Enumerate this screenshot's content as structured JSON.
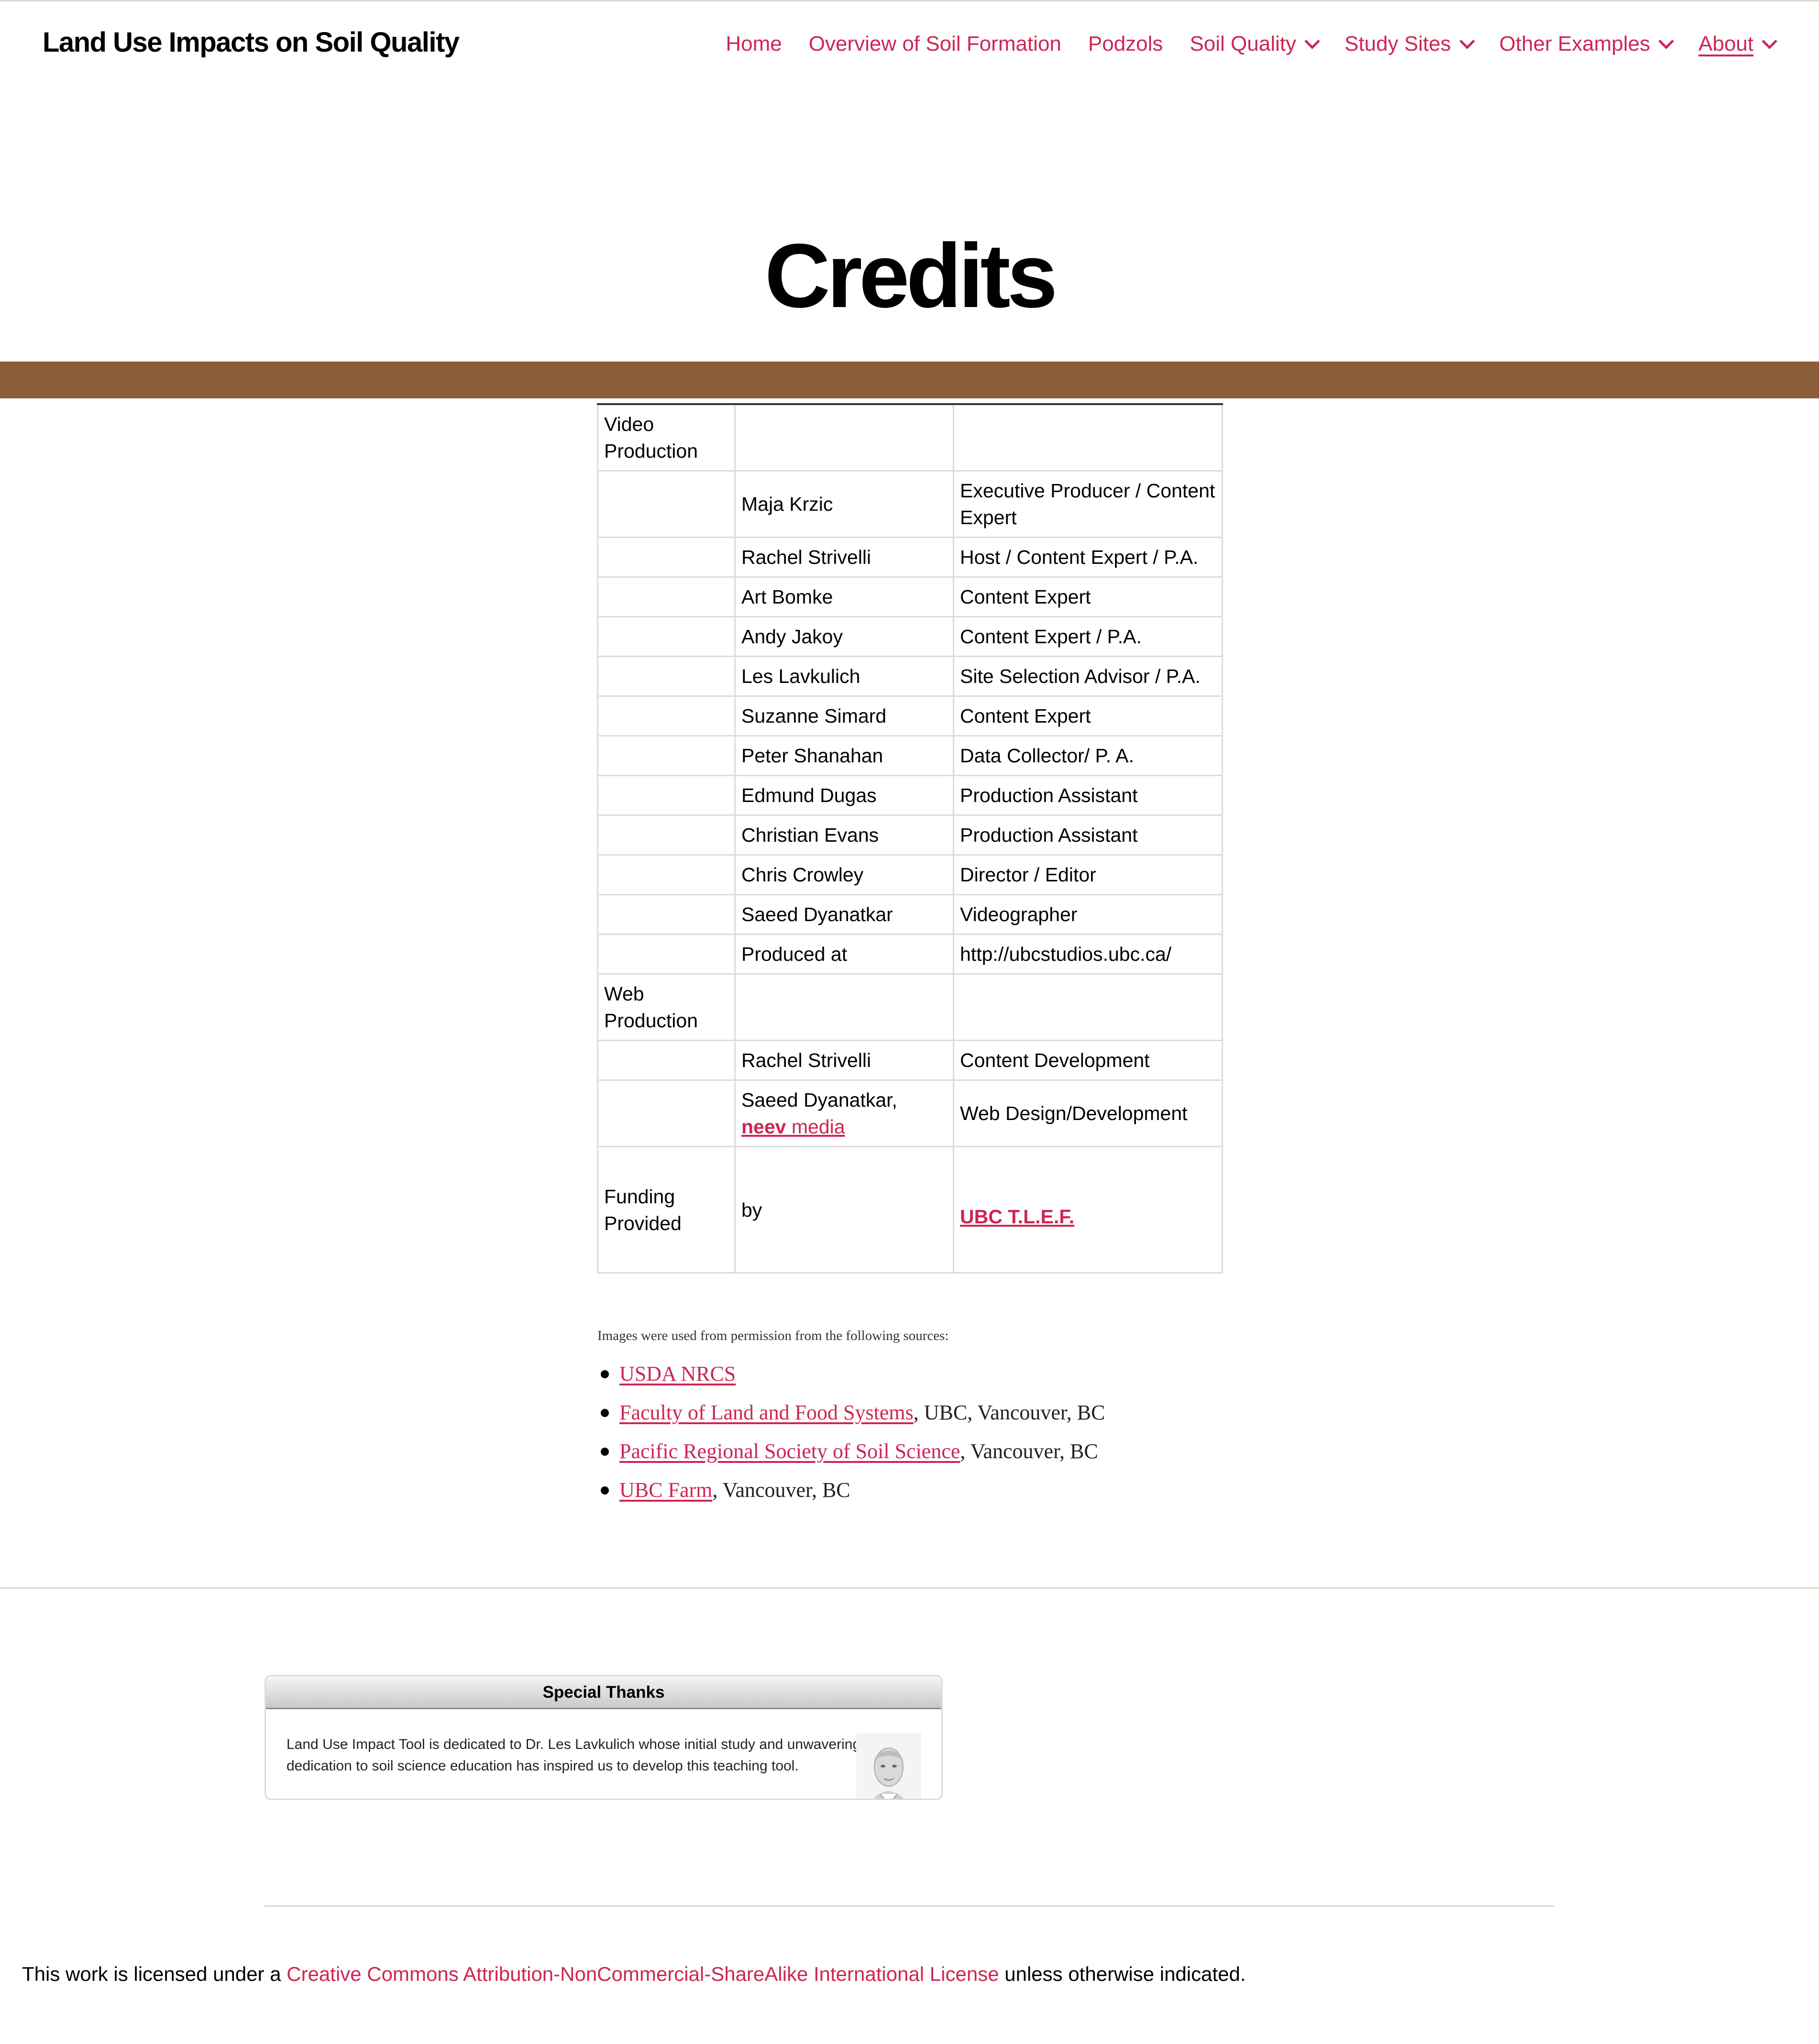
{
  "site": {
    "title": "Land Use Impacts on Soil Quality"
  },
  "menu": [
    {
      "label": "Home",
      "has_submenu": false,
      "current": false
    },
    {
      "label": "Overview of Soil Formation",
      "has_submenu": false,
      "current": false
    },
    {
      "label": "Podzols",
      "has_submenu": false,
      "current": false
    },
    {
      "label": "Soil Quality",
      "has_submenu": true,
      "current": false
    },
    {
      "label": "Study Sites",
      "has_submenu": true,
      "current": false
    },
    {
      "label": "Other Examples",
      "has_submenu": true,
      "current": false
    },
    {
      "label": "About",
      "has_submenu": true,
      "current": true
    }
  ],
  "page": {
    "title": "Credits"
  },
  "colors": {
    "accent": "#cd2653",
    "band": "#8b5e3b",
    "text": "#000000",
    "rule": "#dcd7ca"
  },
  "credits": {
    "video_section": "Video Production",
    "video_rows": [
      {
        "name": "Maja Krzic",
        "role": "Executive Producer / Content Expert"
      },
      {
        "name": "Rachel Strivelli",
        "role": "Host / Content Expert / P.A."
      },
      {
        "name": "Art Bomke",
        "role": "Content Expert"
      },
      {
        "name": "Andy Jakoy",
        "role": "Content Expert / P.A."
      },
      {
        "name": "Les Lavkulich",
        "role": "Site Selection Advisor / P.A."
      },
      {
        "name": "Suzanne Simard",
        "role": "Content Expert"
      },
      {
        "name": "Peter Shanahan",
        "role": "Data Collector/ P. A."
      },
      {
        "name": "Edmund Dugas",
        "role": "Production Assistant"
      },
      {
        "name": "Christian Evans",
        "role": "Production Assistant"
      },
      {
        "name": "Chris Crowley",
        "role": "Director / Editor"
      },
      {
        "name": "Saeed Dyanatkar",
        "role": "Videographer"
      },
      {
        "name": "Produced at",
        "role": "http://ubcstudios.ubc.ca/"
      }
    ],
    "web_section": "Web Production",
    "web_rows": [
      {
        "name": "Rachel Strivelli",
        "role": "Content Development"
      }
    ],
    "web_design": {
      "name": "Saeed Dyanatkar,",
      "link_bold": "neev",
      "link_rest": " media",
      "role": "Web Design/Development"
    },
    "funding": {
      "label": "Funding Provided",
      "by": "by",
      "link": "UBC T.L.E.F."
    }
  },
  "sources": {
    "intro": "Images were used from permission from the following sources:",
    "items": [
      {
        "link": "USDA NRCS",
        "rest": ""
      },
      {
        "link": "Faculty of Land and Food Systems",
        "rest": ", UBC, Vancouver, BC"
      },
      {
        "link": "Pacific Regional Society of Soil Science",
        "rest": ", Vancouver, BC"
      },
      {
        "link": "UBC Farm",
        "rest": ", Vancouver, BC"
      }
    ]
  },
  "special_thanks": {
    "heading": "Special Thanks",
    "text": "Land Use Impact Tool is dedicated to Dr. Les Lavkulich whose initial study and unwavering dedication to soil science education has inspired us to develop this teaching tool.",
    "photo_icon": "portrait-photo"
  },
  "license": {
    "prefix": "This work is licensed under a ",
    "link": "Creative Commons Attribution-NonCommercial-ShareAlike International License",
    "suffix": " unless otherwise indicated."
  }
}
